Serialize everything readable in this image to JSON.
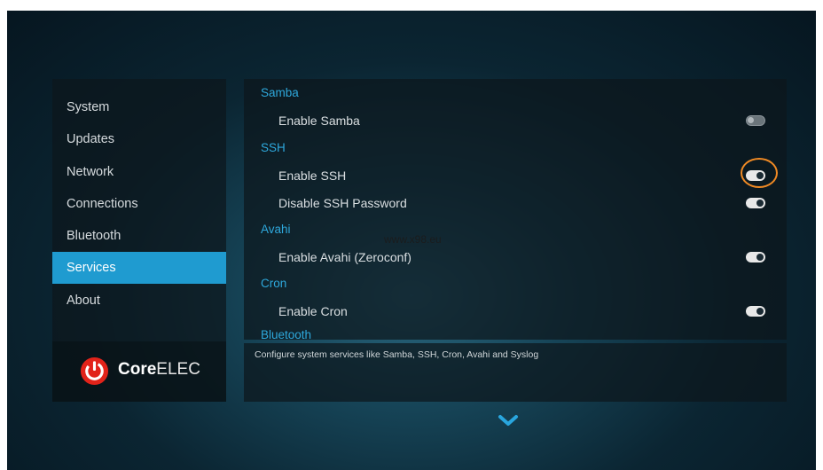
{
  "sidebar": {
    "items": [
      {
        "label": "System"
      },
      {
        "label": "Updates"
      },
      {
        "label": "Network"
      },
      {
        "label": "Connections"
      },
      {
        "label": "Bluetooth"
      },
      {
        "label": "Services",
        "active": true
      },
      {
        "label": "About"
      }
    ],
    "logo": {
      "bold": "Core",
      "light": "ELEC"
    }
  },
  "content": {
    "sections": [
      {
        "header": "Samba",
        "settings": [
          {
            "label": "Enable Samba",
            "state": "off"
          }
        ]
      },
      {
        "header": "SSH",
        "settings": [
          {
            "label": "Enable SSH",
            "state": "on"
          },
          {
            "label": "Disable SSH Password",
            "state": "on"
          }
        ]
      },
      {
        "header": "Avahi",
        "settings": [
          {
            "label": "Enable Avahi (Zeroconf)",
            "state": "on"
          }
        ]
      },
      {
        "header": "Cron",
        "settings": [
          {
            "label": "Enable Cron",
            "state": "on"
          }
        ]
      }
    ],
    "truncated_header": "Bluetooth",
    "watermark": "www.x98.eu"
  },
  "description": "Configure system services like Samba, SSH, Cron, Avahi and Syslog",
  "icons": {
    "scroll": "chevron-down-icon",
    "logo": "power-icon"
  },
  "colors": {
    "accent": "#1f9bd0",
    "section_header": "#2ea8dc",
    "highlight": "#f08a24"
  }
}
